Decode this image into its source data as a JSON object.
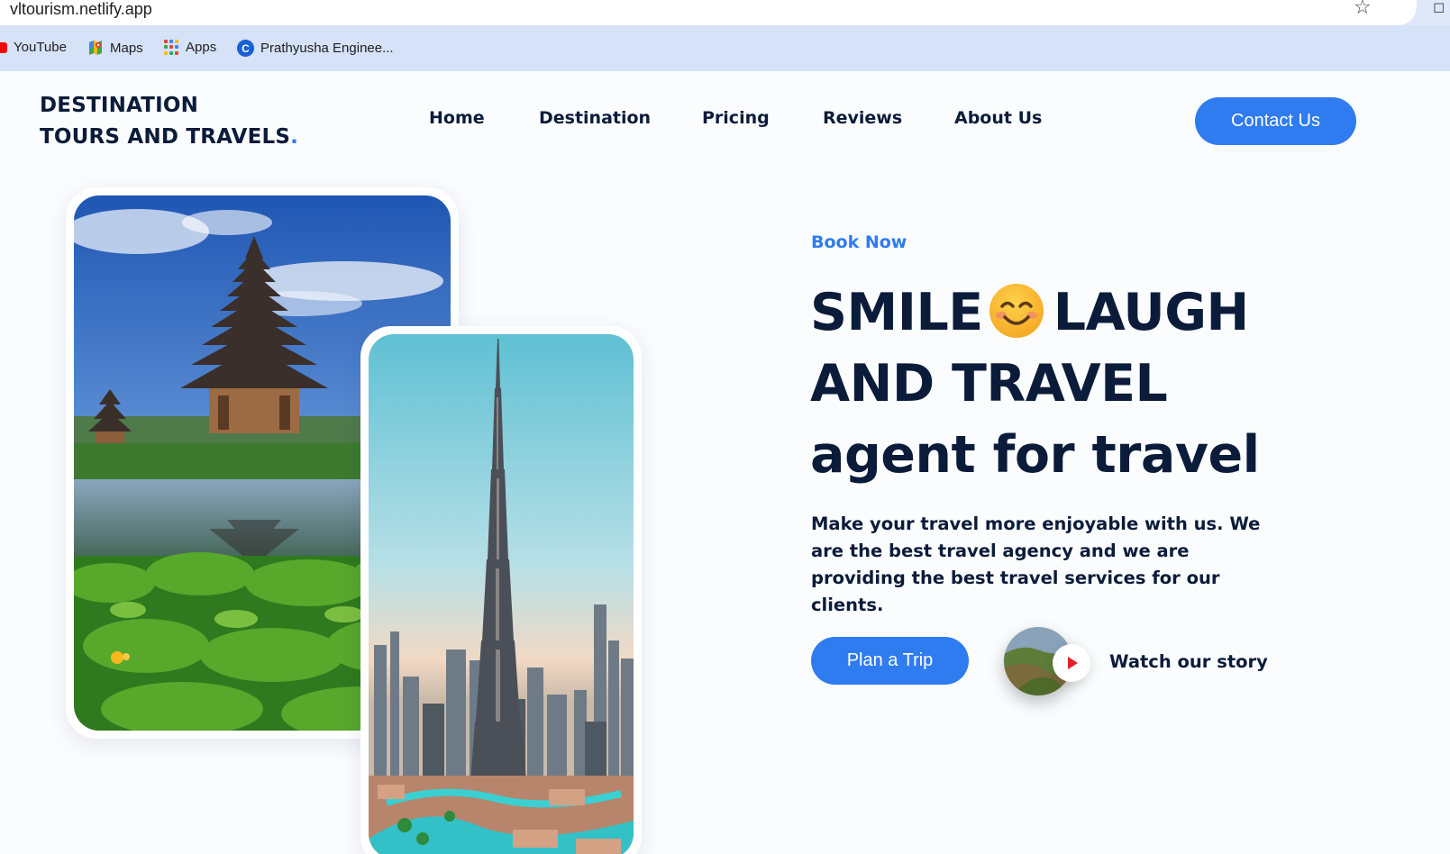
{
  "browser": {
    "url": "vltourism.netlify.app",
    "bookmarks": [
      {
        "label": "YouTube",
        "icon": "youtube-icon"
      },
      {
        "label": "Maps",
        "icon": "maps-icon"
      },
      {
        "label": "Apps",
        "icon": "apps-grid-icon"
      },
      {
        "label": "Prathyusha Enginee...",
        "icon": "college-icon"
      }
    ]
  },
  "site": {
    "brand_line1": "DESTINATION",
    "brand_line2": "TOURS AND TRAVELS",
    "brand_dot": ".",
    "nav": [
      "Home",
      "Destination",
      "Pricing",
      "Reviews",
      "About Us"
    ],
    "contact_label": "Contact Us"
  },
  "hero": {
    "eyebrow": "Book Now",
    "headline_word1": "SMILE",
    "headline_emoji": "smiling-face-icon",
    "headline_word2": "LAUGH",
    "headline_line2": "AND TRAVEL",
    "headline_line3": "agent for travel",
    "description": "Make your travel more enjoyable with us. We are the best travel agency and we are providing the best travel services for our clients.",
    "plan_label": "Plan a Trip",
    "watch_label": "Watch our story"
  },
  "colors": {
    "accent": "#2f7bf0",
    "text": "#0b1c3a",
    "background": "#fbfcfe",
    "bookmark_bar": "#d5e2f7"
  }
}
